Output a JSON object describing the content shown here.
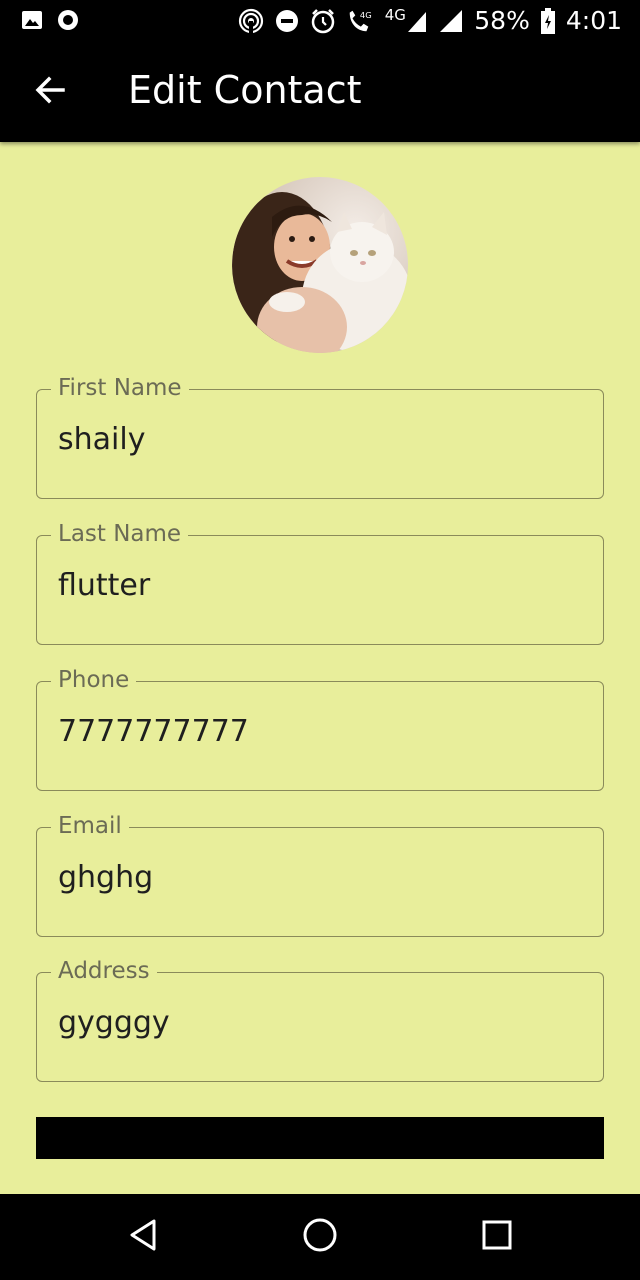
{
  "status_bar": {
    "battery": "58%",
    "time": "4:01",
    "network_label": "4G"
  },
  "app_bar": {
    "title": "Edit Contact",
    "back_icon": "arrow-back-icon"
  },
  "avatar": {
    "icon": "contact-photo"
  },
  "form": {
    "fields": [
      {
        "label": "First Name",
        "value": "shaily"
      },
      {
        "label": "Last Name",
        "value": "flutter"
      },
      {
        "label": "Phone",
        "value": "7777777777"
      },
      {
        "label": "Email",
        "value": "ghghg"
      },
      {
        "label": "Address",
        "value": "gygggy"
      }
    ]
  },
  "nav_bar": {
    "back_icon": "nav-back-icon",
    "home_icon": "nav-home-icon",
    "recents_icon": "nav-recents-icon"
  },
  "colors": {
    "background": "#e8ee9b",
    "app_bar": "#000000",
    "field_border": "#8a8a5a",
    "label": "#6b6b55"
  }
}
